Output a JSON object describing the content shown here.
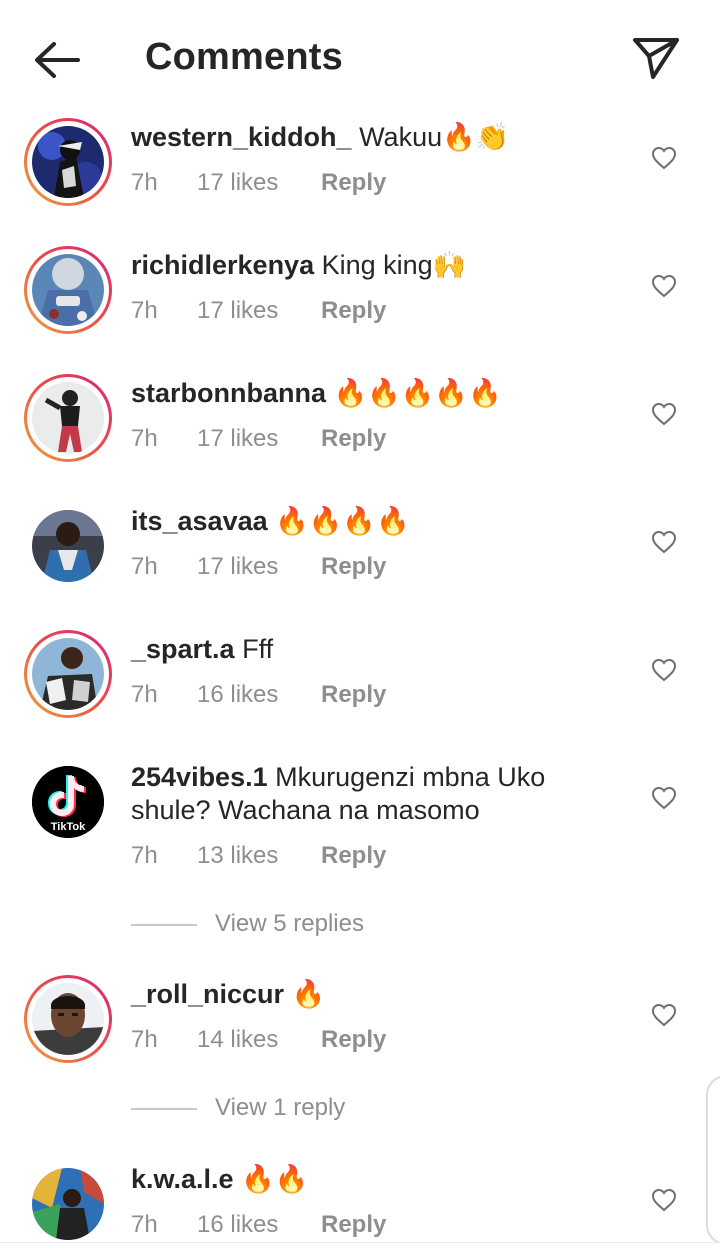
{
  "header": {
    "title": "Comments",
    "back_icon": "arrow-left-icon",
    "share_icon": "paper-plane-icon"
  },
  "colors": {
    "story_ring_start": "#d9247a",
    "story_ring_end": "#f2a33a",
    "muted_text": "#8e8e8e",
    "primary_text": "#262626"
  },
  "comments": [
    {
      "username": "western_kiddoh_",
      "text": "Wakuu🔥👏",
      "time": "7h",
      "likes": "17 likes",
      "reply": "Reply",
      "story_ring": true
    },
    {
      "username": "richidlerkenya",
      "text": "King king🙌",
      "time": "7h",
      "likes": "17 likes",
      "reply": "Reply",
      "story_ring": true
    },
    {
      "username": "starbonnbanna",
      "text": "🔥🔥🔥🔥🔥",
      "time": "7h",
      "likes": "17 likes",
      "reply": "Reply",
      "story_ring": true
    },
    {
      "username": "its_asavaa",
      "text": "🔥🔥🔥🔥",
      "time": "7h",
      "likes": "17 likes",
      "reply": "Reply",
      "story_ring": false
    },
    {
      "username": "_spart.a",
      "text": "Fff",
      "time": "7h",
      "likes": "16 likes",
      "reply": "Reply",
      "story_ring": true
    },
    {
      "username": "254vibes.1",
      "text": "Mkurugenzi mbna Uko shule? Wachana na masomo",
      "time": "7h",
      "likes": "13 likes",
      "reply": "Reply",
      "story_ring": false,
      "avatar_text": "TikTok",
      "view_replies": "View 5 replies"
    },
    {
      "username": "_roll_niccur",
      "text": "🔥",
      "time": "7h",
      "likes": "14 likes",
      "reply": "Reply",
      "story_ring": true,
      "view_replies": "View 1 reply"
    },
    {
      "username": "k.w.a.l.e",
      "text": "🔥🔥",
      "time": "7h",
      "likes": "16 likes",
      "reply": "Reply",
      "story_ring": false
    }
  ]
}
